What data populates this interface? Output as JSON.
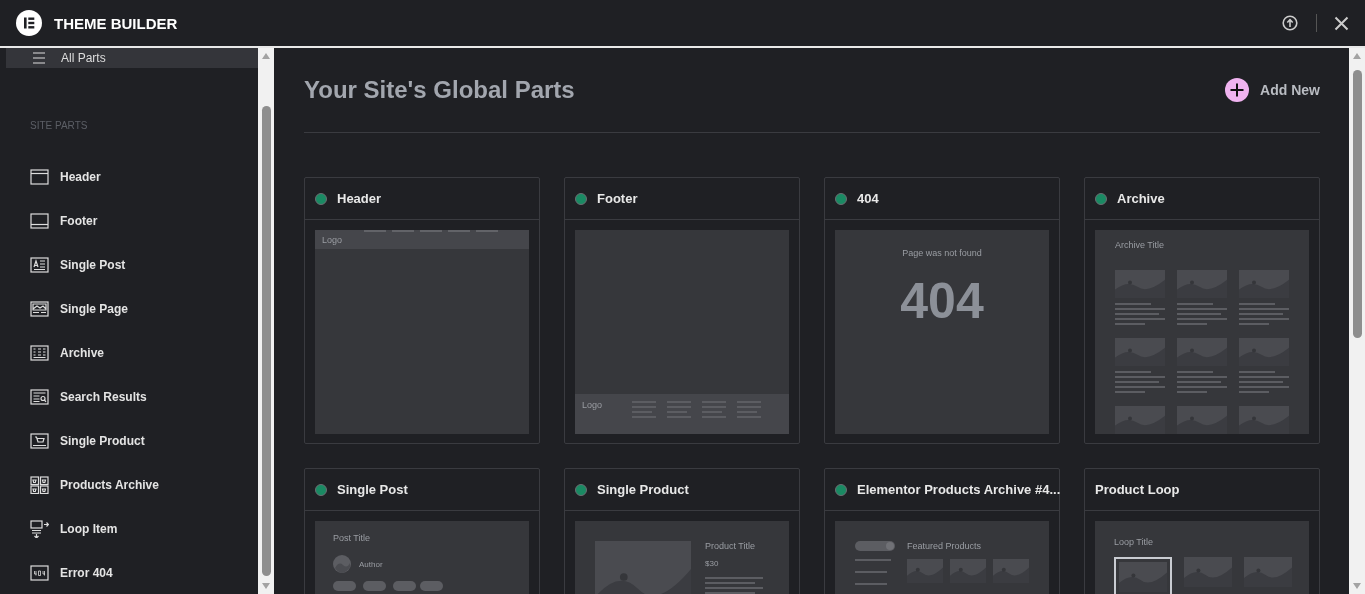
{
  "topbar": {
    "title": "THEME BUILDER"
  },
  "sidebar": {
    "items": [
      {
        "label": "All Parts",
        "selected": true,
        "kind": "list"
      }
    ],
    "section_title": "SITE PARTS",
    "parts": [
      {
        "label": "Header",
        "kind": "header"
      },
      {
        "label": "Footer",
        "kind": "footer"
      },
      {
        "label": "Single Post",
        "kind": "post"
      },
      {
        "label": "Single Page",
        "kind": "page"
      },
      {
        "label": "Archive",
        "kind": "archive"
      },
      {
        "label": "Search Results",
        "kind": "search"
      },
      {
        "label": "Single Product",
        "kind": "product"
      },
      {
        "label": "Products Archive",
        "kind": "products"
      },
      {
        "label": "Loop Item",
        "kind": "loop"
      },
      {
        "label": "Error 404",
        "kind": "error"
      }
    ]
  },
  "main": {
    "title": "Your Site's Global Parts",
    "add_button": "Add New",
    "cards": [
      {
        "title": "Header",
        "published": true,
        "preview": {
          "kind": "header",
          "texts": [
            "Logo"
          ]
        }
      },
      {
        "title": "Footer",
        "published": true,
        "preview": {
          "kind": "footer",
          "texts": [
            "Logo"
          ]
        }
      },
      {
        "title": "404",
        "published": true,
        "preview": {
          "kind": "error",
          "texts": [
            "Page was not found",
            "404"
          ]
        }
      },
      {
        "title": "Archive",
        "published": true,
        "preview": {
          "kind": "archive",
          "texts": [
            "Archive Title"
          ]
        }
      },
      {
        "title": "Single Post",
        "published": true,
        "preview": {
          "kind": "post",
          "texts": [
            "Post Title",
            "Author"
          ]
        }
      },
      {
        "title": "Single Product",
        "published": true,
        "preview": {
          "kind": "product",
          "texts": [
            "Product Title",
            "$30"
          ]
        }
      },
      {
        "title": "Elementor Products Archive #4...",
        "published": true,
        "preview": {
          "kind": "products",
          "texts": [
            "Featured Products"
          ]
        }
      },
      {
        "title": "Product Loop",
        "published": false,
        "preview": {
          "kind": "loop",
          "texts": [
            "Loop Title"
          ]
        }
      }
    ]
  }
}
